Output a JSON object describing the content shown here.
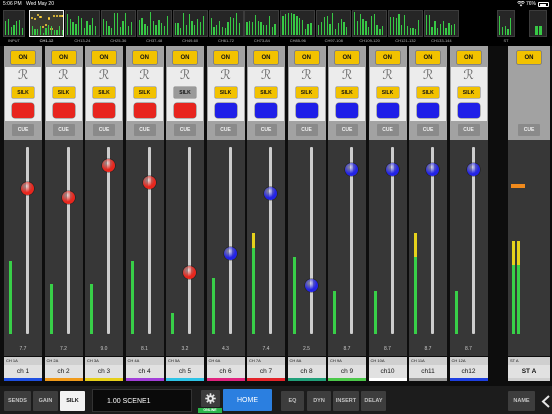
{
  "status_bar": {
    "time": "5:06 PM",
    "date": "Wed May 20",
    "battery": "76%",
    "battery_level": 0.76,
    "icons": [
      "wifi-icon",
      "battery-icon"
    ]
  },
  "overview": {
    "tabs": [
      {
        "label": "INPUT"
      },
      {
        "label": "CH1-12",
        "selected": true
      },
      {
        "label": "CH13-24"
      },
      {
        "label": "CH25-36"
      },
      {
        "label": "CH37-48"
      },
      {
        "label": "CH49-60"
      },
      {
        "label": "CH61-72"
      },
      {
        "label": "CH73-84"
      },
      {
        "label": "CH85-96"
      },
      {
        "label": "CH97-108"
      },
      {
        "label": "CH109-120"
      },
      {
        "label": "CH121-132"
      },
      {
        "label": "CH133-144"
      },
      {
        "label": "ST"
      }
    ]
  },
  "channels": [
    {
      "header": "CH 1A",
      "name": "ch 1",
      "value": "7.7",
      "on_label": "ON",
      "silk_label": "SILK",
      "silk_on": true,
      "cue_label": "CUE",
      "icon": "channel-icon",
      "color": "#e8241e",
      "knob_color": "#e8261d",
      "fader_level": 0.78,
      "meter_level": 0.39,
      "label_color": "#1e4fe0"
    },
    {
      "header": "CH 2A",
      "name": "ch 2",
      "value": "7.2",
      "on_label": "ON",
      "silk_label": "SILK",
      "silk_on": true,
      "cue_label": "CUE",
      "icon": "channel-icon",
      "color": "#e8241e",
      "knob_color": "#e8261d",
      "fader_level": 0.73,
      "meter_level": 0.27,
      "label_color": "#f09a1a"
    },
    {
      "header": "CH 3A",
      "name": "ch 3",
      "value": "9.0",
      "on_label": "ON",
      "silk_label": "SILK",
      "silk_on": true,
      "cue_label": "CUE",
      "icon": "channel-icon",
      "color": "#e8241e",
      "knob_color": "#e8261d",
      "fader_level": 0.9,
      "meter_level": 0.27,
      "label_color": "#e6cf1a"
    },
    {
      "header": "CH 4A",
      "name": "ch 4",
      "value": "8.1",
      "on_label": "ON",
      "silk_label": "SILK",
      "silk_on": true,
      "cue_label": "CUE",
      "icon": "channel-icon",
      "color": "#e8241e",
      "knob_color": "#e8261d",
      "fader_level": 0.81,
      "meter_level": 0.39,
      "label_color": "#a23fd8"
    },
    {
      "header": "CH 5A",
      "name": "ch 5",
      "value": "3.2",
      "on_label": "ON",
      "silk_label": "SILK",
      "silk_on": false,
      "cue_label": "CUE",
      "icon": "channel-icon",
      "color": "#e8241e",
      "knob_color": "#e8261d",
      "fader_level": 0.33,
      "meter_level": 0.11,
      "label_color": "#2ec3e6"
    },
    {
      "header": "CH 6A",
      "name": "ch 6",
      "value": "4.3",
      "on_label": "ON",
      "silk_label": "SILK",
      "silk_on": true,
      "cue_label": "CUE",
      "icon": "channel-icon",
      "color": "#1f1fe8",
      "knob_color": "#2323e6",
      "fader_level": 0.43,
      "meter_level": 0.3,
      "label_color": "#e0247e"
    },
    {
      "header": "CH 7A",
      "name": "ch 7",
      "value": "7.4",
      "on_label": "ON",
      "silk_label": "SILK",
      "silk_on": true,
      "cue_label": "CUE",
      "icon": "channel-icon",
      "color": "#1f1fe8",
      "knob_color": "#2323e6",
      "fader_level": 0.75,
      "meter_level": 0.46,
      "meter_peak": 0.54,
      "label_color": "#e3242a"
    },
    {
      "header": "CH 8A",
      "name": "ch 8",
      "value": "2.5",
      "on_label": "ON",
      "silk_label": "SILK",
      "silk_on": true,
      "cue_label": "CUE",
      "icon": "channel-icon",
      "color": "#1f1fe8",
      "knob_color": "#2323e6",
      "fader_level": 0.26,
      "meter_level": 0.41,
      "label_color": "#21a07a"
    },
    {
      "header": "CH 9A",
      "name": "ch 9",
      "value": "8.7",
      "on_label": "ON",
      "silk_label": "SILK",
      "silk_on": true,
      "cue_label": "CUE",
      "icon": "channel-icon",
      "color": "#1f1fe8",
      "knob_color": "#2323e6",
      "fader_level": 0.88,
      "meter_level": 0.23,
      "label_color": "#4cc84a"
    },
    {
      "header": "CH 10A",
      "name": "ch10",
      "value": "8.7",
      "on_label": "ON",
      "silk_label": "SILK",
      "silk_on": true,
      "cue_label": "CUE",
      "icon": "channel-icon",
      "color": "#1f1fe8",
      "knob_color": "#2323e6",
      "fader_level": 0.88,
      "meter_level": 0.23,
      "label_color": "#ffffff"
    },
    {
      "header": "CH 11A",
      "name": "ch11",
      "value": "8.7",
      "on_label": "ON",
      "silk_label": "SILK",
      "silk_on": true,
      "cue_label": "CUE",
      "icon": "channel-icon",
      "color": "#1f1fe8",
      "knob_color": "#2323e6",
      "fader_level": 0.88,
      "meter_level": 0.41,
      "meter_peak": 0.54,
      "label_color": "#9a9a9a"
    },
    {
      "header": "CH 12A",
      "name": "ch12",
      "value": "8.7",
      "on_label": "ON",
      "silk_label": "SILK",
      "silk_on": true,
      "cue_label": "CUE",
      "icon": "channel-icon",
      "color": "#1f1fe8",
      "knob_color": "#2323e6",
      "fader_level": 0.88,
      "meter_level": 0.23,
      "label_color": "#1e3fe0"
    }
  ],
  "stereo": {
    "header": "ST A",
    "name": "ST A",
    "on_label": "ON",
    "cue_label": "CUE",
    "fader_level": 0.79,
    "meter_level": 0.37,
    "meter_peak": 0.5,
    "label_color": "#cfcfcf"
  },
  "bottom_bar": {
    "tabs": [
      {
        "label": "SENDS"
      },
      {
        "label": "GAIN"
      },
      {
        "label": "SILK",
        "selected": true
      }
    ],
    "scene": "1.00 SCENE1",
    "setup_icon": "gear-icon",
    "online": "ONLINE",
    "home": "HOME",
    "functions": [
      {
        "label": "EQ"
      },
      {
        "label": "DYN"
      },
      {
        "label": "INSERT"
      },
      {
        "label": "DELAY"
      }
    ],
    "name": "NAME",
    "handle_icon": "chevron-left-icon"
  },
  "colors": {
    "on_button": "#f2c200",
    "silk_on": "#f2c200",
    "silk_off": "#9a9a9a",
    "meter_green": "#38cf48",
    "meter_yellow": "#e6d21c",
    "stereo_fader": "#f08a1c",
    "home_blue": "#2b7fe0",
    "online_green": "#2bb54a"
  }
}
